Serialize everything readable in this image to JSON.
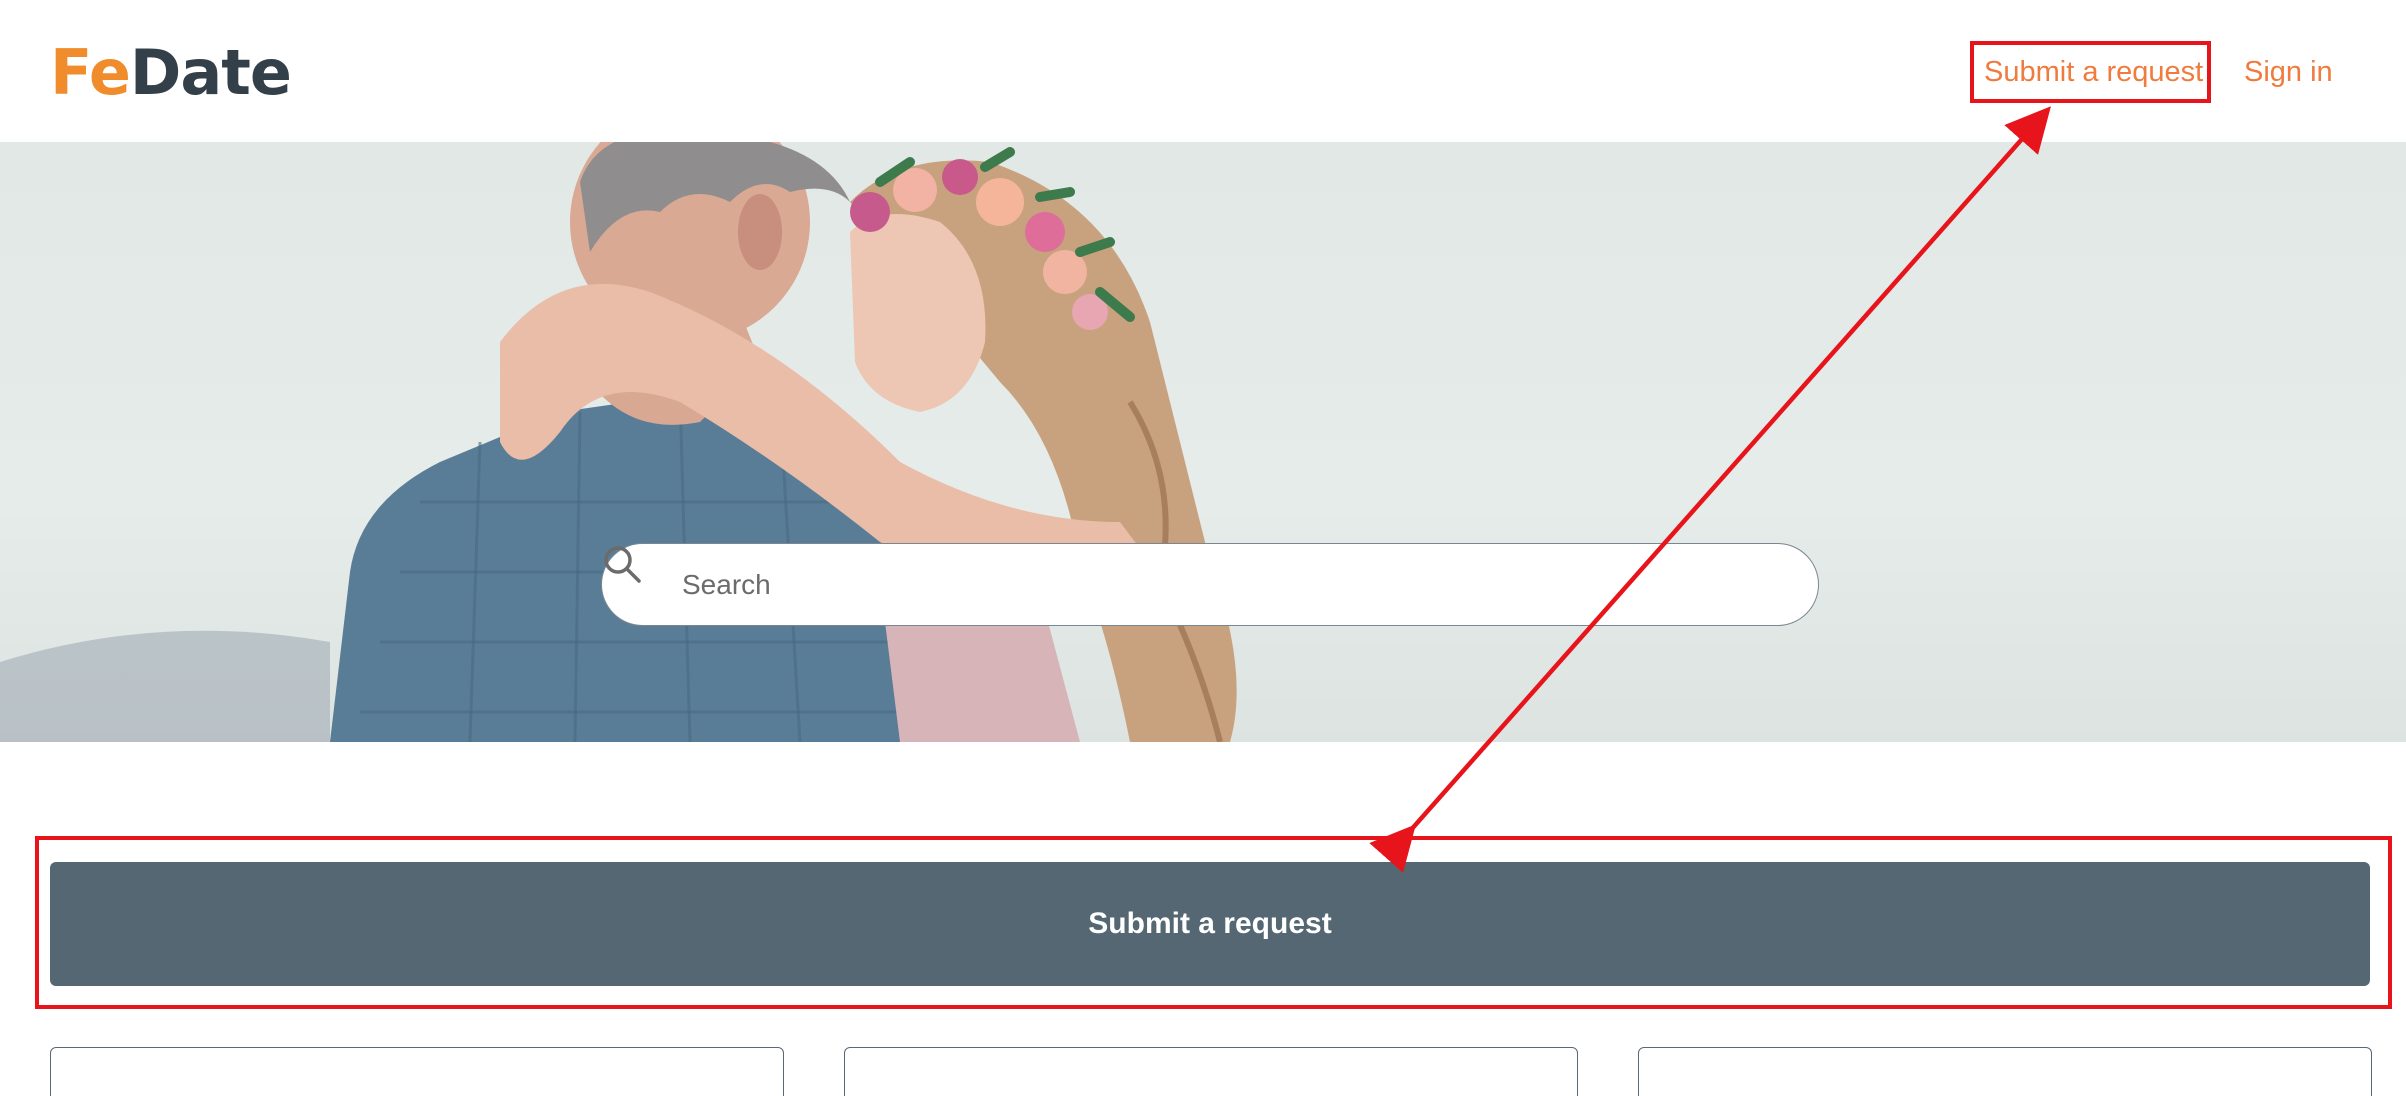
{
  "colors": {
    "brand_orange": "#f08c2b",
    "brand_dark": "#344049",
    "link_color": "#ef7b3e",
    "button_bg": "#546773",
    "annotation_red": "#e8141b"
  },
  "header": {
    "logo_part1": "Fe",
    "logo_part2": "Date",
    "nav": {
      "submit_request": "Submit a request",
      "sign_in": "Sign in"
    }
  },
  "hero": {
    "image": "couple-embracing-photo",
    "search": {
      "icon": "search-icon",
      "placeholder": "Search"
    }
  },
  "main": {
    "submit_button_label": "Submit a request",
    "cards": [
      "",
      "",
      ""
    ]
  },
  "annotations": {
    "style": "red-box-with-double-arrow",
    "targets": [
      "header-submit-request-link",
      "submit-request-button"
    ]
  }
}
